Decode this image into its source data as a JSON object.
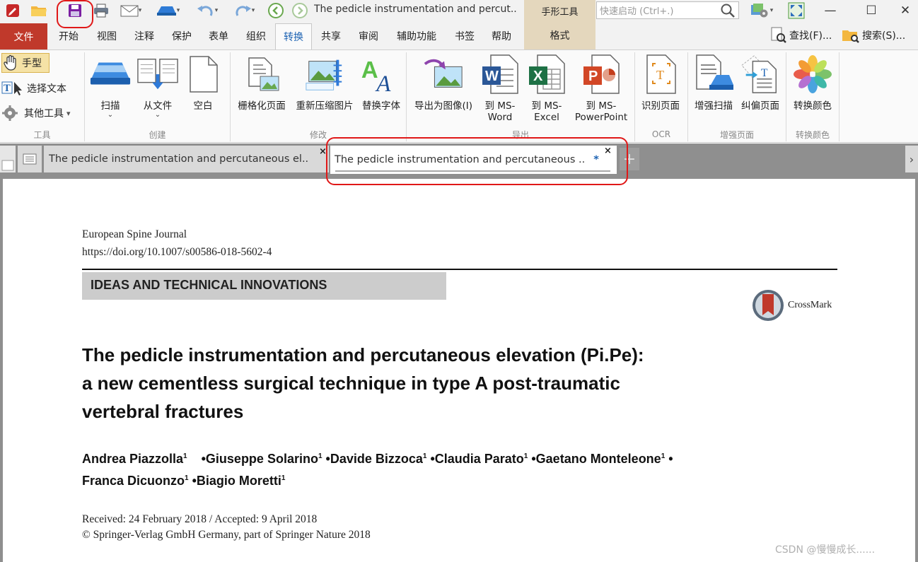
{
  "title_bar": {
    "document_title": "The pedicle instrumentation and percut..",
    "context_tab_group": "手形工具",
    "quick_launch_placeholder": "快速启动 (Ctrl+.)"
  },
  "menu": {
    "file": "文件",
    "tabs": [
      "开始",
      "视图",
      "注释",
      "保护",
      "表单",
      "组织",
      "转换",
      "共享",
      "审阅",
      "辅助功能",
      "书签",
      "帮助"
    ],
    "active_tab": "转换",
    "context_tab": "格式",
    "find": "查找(F)...",
    "search": "搜索(S)..."
  },
  "ribbon": {
    "tools_group": {
      "hand": "手型",
      "select_text": "选择文本",
      "other_tools": "其他工具",
      "label": "工具"
    },
    "create_group": {
      "scan": "扫描",
      "from_file": "从文件",
      "blank": "空白",
      "label": "创建"
    },
    "modify_group": {
      "rasterize": "栅格化页面",
      "recompress": "重新压缩图片",
      "replace_font": "替换字体",
      "label": "修改"
    },
    "export_group": {
      "export_image": "导出为图像(I)",
      "to_word": [
        "到 MS-",
        "Word"
      ],
      "to_excel": [
        "到 MS-",
        "Excel"
      ],
      "to_ppt": [
        "到 MS-",
        "PowerPoint"
      ],
      "label": "导出"
    },
    "ocr_group": {
      "recognize": "识别页面",
      "label": "OCR"
    },
    "enhance_group": {
      "enhance_scan": "增强扫描",
      "deskew": "纠偏页面",
      "label": "增强页面"
    },
    "color_group": {
      "convert_color": "转换颜色",
      "label": "转换颜色"
    }
  },
  "doc_tabs": [
    {
      "title": "The pedicle instrumentation and percutaneous el..",
      "modified": false
    },
    {
      "title": "The pedicle instrumentation and percutaneous ..",
      "modified": true,
      "modified_mark": "*"
    }
  ],
  "document": {
    "journal": "European Spine Journal",
    "doi": "https://doi.org/10.1007/s00586-018-5602-4",
    "section": "IDEAS AND TECHNICAL INNOVATIONS",
    "crossmark": "CrossMark",
    "title_lines": [
      "The pedicle instrumentation and percutaneous elevation (Pi.Pe):",
      "a new cementless surgical technique in type A post-traumatic",
      "vertebral fractures"
    ],
    "authors_line1": [
      {
        "name": "Andrea Piazzolla",
        "sup": "1"
      },
      {
        "name": "Giuseppe Solarino",
        "sup": "1"
      },
      {
        "name": "Davide Bizzoca",
        "sup": "1"
      },
      {
        "name": "Claudia Parato",
        "sup": "1"
      },
      {
        "name": "Gaetano Monteleone",
        "sup": "1"
      }
    ],
    "authors_line2": [
      {
        "name": "Franca Dicuonzo",
        "sup": "1"
      },
      {
        "name": "Biagio Moretti",
        "sup": "1"
      }
    ],
    "received": "Received: 24 February 2018 / Accepted: 9 April 2018",
    "copyright": "© Springer-Verlag GmbH Germany, part of Springer Nature 2018"
  },
  "watermark": "CSDN @慢慢成长......",
  "colors": {
    "file_tab": "#c0392b",
    "active_tab_text": "#1d63b3",
    "context_tab": "#e4d7bd",
    "highlight_circle": "#e01818",
    "section_banner": "#cccccc"
  }
}
